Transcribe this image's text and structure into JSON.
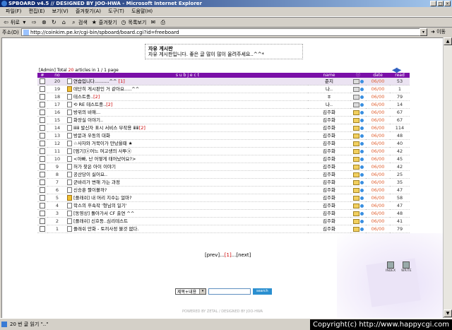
{
  "window": {
    "title": "SPBOARD v4.5 // DESIGNED BY JOO-HWA - Microsoft Internet Explorer"
  },
  "menu": [
    "파일(F)",
    "편집(E)",
    "보기(V)",
    "즐겨찾기(A)",
    "도구(T)",
    "도움말(H)"
  ],
  "toolbar": {
    "back": "뒤로",
    "search": "검색",
    "favorites": "즐겨찾기",
    "history": "목록보기"
  },
  "address": {
    "label": "주소(D)",
    "url": "http://coinkim.pe.kr/cgi-bin/spboard/board.cgi?id=freeboard",
    "go": "이동"
  },
  "notice": {
    "title": "자유 게시판",
    "body": "자유 게시판입니다. 좋은 글 많이 많이 올려주세요..^^*"
  },
  "total": {
    "prefix": "[Admin] Total ",
    "count": "20",
    "suffix": " articles in 1 / 1 page"
  },
  "table": {
    "headers": [
      "#",
      "no",
      "s u b j e c t",
      "name",
      "ⓘ",
      "date",
      "read"
    ],
    "rows": [
      {
        "no": "20",
        "subject": "연습입니다..........^^ ",
        "comments": "[1]",
        "name": "준지",
        "date": "06/00",
        "read": "53",
        "icon": "doc"
      },
      {
        "no": "19",
        "subject": "데단히 게시판인 거 같아요.....^^",
        "comments": "",
        "name": "나..",
        "date": "06/00",
        "read": "1",
        "icon": "notice"
      },
      {
        "no": "18",
        "subject": "테스트중..",
        "comments": "[2]",
        "name": "ㅎ",
        "date": "06/00",
        "read": "79",
        "icon": "doc"
      },
      {
        "no": "17",
        "subject": "⟲ RE 테스트중..",
        "comments": "[2]",
        "name": "나..",
        "date": "06/00",
        "read": "14",
        "icon": "doc"
      },
      {
        "no": "16",
        "subject": "방위의 비애...",
        "comments": "",
        "name": "김주화",
        "date": "06/00",
        "read": "67",
        "icon": "doc"
      },
      {
        "no": "15",
        "subject": "화장실 이야기..",
        "comments": "",
        "name": "김주화",
        "date": "06/00",
        "read": "67",
        "icon": "doc"
      },
      {
        "no": "14",
        "subject": "ⅲⅲ 발신자 표시 서비스 부작용 ⅲⅲ",
        "comments": "[2]",
        "name": "김주화",
        "date": "06/00",
        "read": "114",
        "icon": "doc"
      },
      {
        "no": "13",
        "subject": "방문과 우동의 대화",
        "comments": "",
        "name": "김주화",
        "date": "06/00",
        "read": "48",
        "icon": "doc"
      },
      {
        "no": "12",
        "subject": "☆사자와 거북이가 만났을때 ★",
        "comments": "",
        "name": "김주화",
        "date": "06/00",
        "read": "40",
        "icon": "doc"
      },
      {
        "no": "11",
        "subject": "[펌기]ⓐ어느 여고생의 사투ⓐ",
        "comments": "",
        "name": "김주화",
        "date": "06/00",
        "read": "42",
        "icon": "doc"
      },
      {
        "no": "10",
        "subject": "<아빠, 난 어떻게 태어났어요?>",
        "comments": "",
        "name": "김주화",
        "date": "06/00",
        "read": "45",
        "icon": "doc"
      },
      {
        "no": "9",
        "subject": "허가 찾은 아이 이야기",
        "comments": "",
        "name": "김주화",
        "date": "06/00",
        "read": "42",
        "icon": "doc"
      },
      {
        "no": "8",
        "subject": "공산당이 싫어요..",
        "comments": "",
        "name": "김주화",
        "date": "06/00",
        "read": "25",
        "icon": "doc"
      },
      {
        "no": "7",
        "subject": "군바리가 변해 가는 과정",
        "comments": "",
        "name": "김주화",
        "date": "06/00",
        "read": "35",
        "icon": "doc"
      },
      {
        "no": "6",
        "subject": "신승훈 짤이볼까?",
        "comments": "",
        "name": "김주화",
        "date": "06/00",
        "read": "47",
        "icon": "doc"
      },
      {
        "no": "5",
        "subject": "[플래쉬] 내 머리 지수는 얼마?",
        "comments": "",
        "name": "김주화",
        "date": "06/00",
        "read": "58",
        "icon": "notice"
      },
      {
        "no": "4",
        "subject": "학스의 후속작 '형님의 일기'",
        "comments": "",
        "name": "김주화",
        "date": "06/00",
        "read": "47",
        "icon": "doc"
      },
      {
        "no": "3",
        "subject": "[동영상] 돌아가서 CF 출연 ^^",
        "comments": "",
        "name": "김주화",
        "date": "06/00",
        "read": "48",
        "icon": "doc"
      },
      {
        "no": "2",
        "subject": "[플래쉬] 신호등..심리테스트",
        "comments": "",
        "name": "김주화",
        "date": "06/00",
        "read": "41",
        "icon": "doc"
      },
      {
        "no": "1",
        "subject": "플래쉬 만화 - 토끼사정 불것 없다.",
        "comments": "",
        "name": "김주화",
        "date": "06/00",
        "read": "79",
        "icon": "doc"
      }
    ]
  },
  "pager": {
    "prev": "[prev]...",
    "current": "[1]",
    "next": "...[next]"
  },
  "search": {
    "option": "제목+내용",
    "button": "search"
  },
  "sidebuttons": {
    "index": "INDEX",
    "write": "WRITE"
  },
  "footer": "POWERED BY ZETAL / DESIGNED BY JOO-HWA",
  "status": {
    "text": "20 번 글 읽기 \"..\""
  },
  "copyright": "Copyright(c) http://www.happycgi.com"
}
